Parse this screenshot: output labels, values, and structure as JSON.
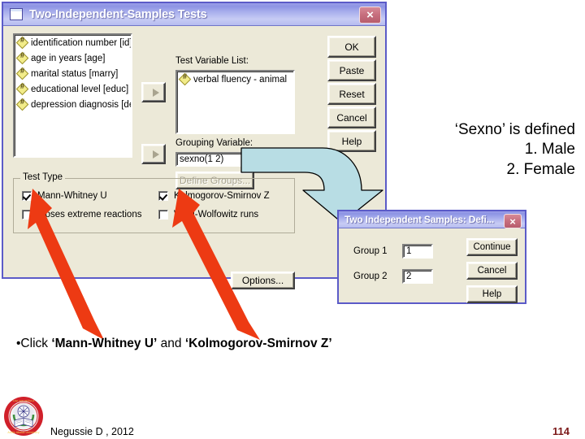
{
  "slide": {
    "note_right": [
      "‘Sexno’ is defined",
      "1. Male",
      "2. Female"
    ],
    "bullet": {
      "prefix": "•Click ",
      "bold1": "‘Mann-Whitney U’",
      "middle": " and ",
      "bold2": "‘Kolmogorov-Smirnov Z’"
    },
    "footer_text": "Negussie D , 2012",
    "page_number": "114",
    "logo_name": "university-seal"
  },
  "main_dialog": {
    "title": "Two-Independent-Samples Tests",
    "close_label": "×",
    "source_variables": [
      "identification number [id]",
      "age in years [age]",
      "marital status [marry]",
      "educational level [educ]",
      "depression diagnosis [dep]"
    ],
    "test_variable_label": "Test Variable List:",
    "test_variables": [
      "verbal fluency - animal"
    ],
    "grouping_variable_label": "Grouping Variable:",
    "grouping_variable_value": "sexno(1 2)",
    "define_groups_label": "Define Groups...",
    "options_label": "Options...",
    "side_buttons": [
      {
        "label": "OK"
      },
      {
        "label": "Paste"
      },
      {
        "label": "Reset"
      },
      {
        "label": "Cancel"
      },
      {
        "label": "Help"
      }
    ],
    "test_type": {
      "legend": "Test Type",
      "items": [
        {
          "label": "Mann-Whitney U",
          "checked": true
        },
        {
          "label": "Kolmogorov-Smirnov Z",
          "checked": true
        },
        {
          "label": "Moses extreme reactions",
          "checked": false
        },
        {
          "label": "Wald-Wolfowitz runs",
          "checked": false
        }
      ]
    }
  },
  "define_dialog": {
    "title": "Two Independent Samples: Defi...",
    "close_label": "×",
    "group1_label": "Group 1",
    "group1_value": "1",
    "group2_label": "Group 2",
    "group2_value": "2",
    "buttons": [
      {
        "label": "Continue"
      },
      {
        "label": "Cancel"
      },
      {
        "label": "Help"
      }
    ]
  },
  "colors": {
    "titlebar_blue": "#9aa0e8",
    "dialog_face": "#ece9d8",
    "dialog_border": "#5b5bc8",
    "red_arrow": "#ed3a13",
    "blue_arrow": "#b8dde4",
    "page_number": "#7c1a1a",
    "close_button": "#c8707f"
  }
}
